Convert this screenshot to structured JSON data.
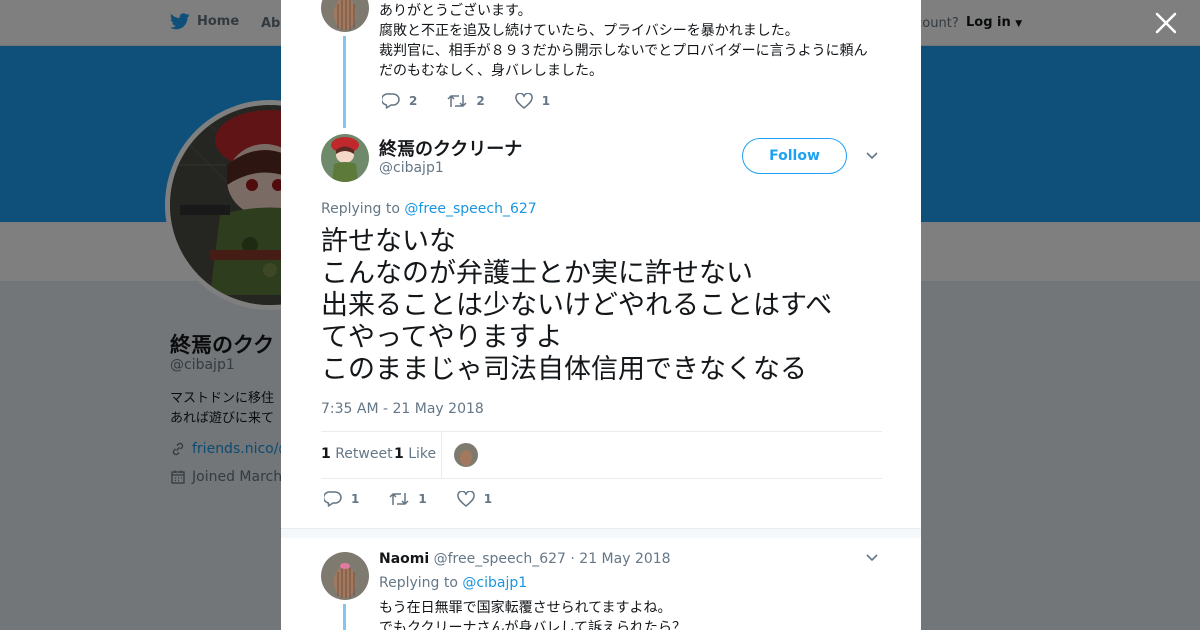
{
  "background": {
    "nav": {
      "home": "Home",
      "about": "Abo",
      "account": "ccount?",
      "login": "Log in"
    },
    "profile": {
      "name": "終焉のクク",
      "handle": "@cibajp1",
      "bio_line1": "マストドンに移住",
      "bio_line2": "あれば遊びに来て",
      "link": "friends.nico/@",
      "joined": "Joined March"
    }
  },
  "prev_reply": {
    "lines": [
      "ありがとうございます。",
      "腐敗と不正を追及し続けていたら、プライバシーを暴かれました。",
      "裁判官に、相手が８９３だから開示しないでとプロバイダーに言うように頼ん",
      "だのもむなしく、身バレしました。"
    ],
    "reply_count": "2",
    "retweet_count": "2",
    "like_count": "1"
  },
  "main_tweet": {
    "name": "終焉のククリーナ",
    "handle": "@cibajp1",
    "follow_label": "Follow",
    "replying_prefix": "Replying to",
    "replying_to": "@free_speech_627",
    "lines": [
      "許せないな",
      "こんなのが弁護士とか実に許せない",
      "出来ることは少ないけどやれることはすべ",
      "てやってやりますよ",
      "このままじゃ司法自体信用できなくなる"
    ],
    "timestamp": "7:35 AM - 21 May 2018",
    "retweets_count": "1",
    "retweets_label": "Retweet",
    "likes_count": "1",
    "likes_label": "Like",
    "reply_count": "1",
    "retweet_count": "1",
    "like_count": "1"
  },
  "next_reply": {
    "name": "Naomi",
    "handle": "@free_speech_627",
    "date": "· 21 May 2018",
    "replying_prefix": "Replying to",
    "replying_to": "@cibajp1",
    "lines": [
      "もう在日無罪で国家転覆させられてますよね。",
      "でもククリーナさんが身バレして訴えられたら？"
    ]
  },
  "colors": {
    "brand_blue": "#1da1f2",
    "link_blue": "#1b95e0",
    "thread_line": "#80c6f2",
    "muted": "#657786"
  },
  "icons": [
    "twitter-bird-icon",
    "close-icon",
    "reply-icon",
    "retweet-icon",
    "heart-icon",
    "chevron-down-icon",
    "link-icon",
    "calendar-icon"
  ]
}
